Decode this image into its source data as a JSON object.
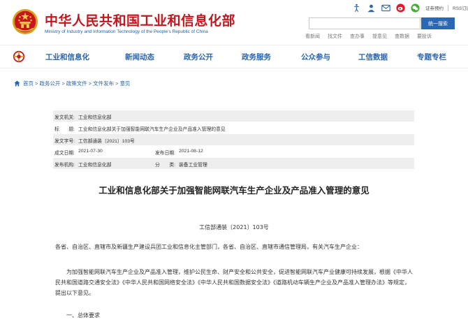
{
  "header": {
    "title": "中华人民共和国工业和信息化部",
    "subtitle": "Ministry of Industry and Information Technology of the People's Republic of China",
    "tools": {
      "icons": [
        "accessibility-icon",
        "user-icon",
        "mail-icon",
        "weibo-icon",
        "wechat-icon"
      ],
      "appointment_label": "证券预约",
      "rss_label": "RSS订阅"
    },
    "search": {
      "value": "",
      "placeholder": "",
      "button_label": "统一搜索"
    },
    "quick_links": [
      "看新闻",
      "找文件",
      "查办事",
      "提意见",
      "查数据",
      "要投诉"
    ]
  },
  "nav": {
    "items": [
      "工业和信息化",
      "新闻动态",
      "政务公开",
      "政务服务",
      "公众参与",
      "工信数据",
      "专题专栏"
    ]
  },
  "breadcrumb": {
    "items": [
      "首页",
      "政务公开",
      "政策文件",
      "文件发布",
      "意见"
    ],
    "separator": ">"
  },
  "meta": {
    "issuer_label": "发文机关:",
    "issuer": "工业和信息化部",
    "title_label": "标　　题:",
    "title": "工业和信息化部关于加强智能网联汽车生产企业及产品准入管理的意见",
    "doc_no_label": "发文字号:",
    "doc_no": "工信部通装〔2021〕103号",
    "created_label": "成文日期:",
    "created": "2021-07-30",
    "published_label": "发布日期:",
    "published": "2021-08-12",
    "org_label": "发布机构:",
    "org": "工业和信息化部",
    "category_label": "分　　类:",
    "category": "装备工业管理"
  },
  "article": {
    "title": "工业和信息化部关于加强智能网联汽车生产企业及产品准入管理的意见",
    "doc_no": "工信部通装〔2021〕103号",
    "addressee": "各省、自治区、直辖市及新疆生产建设兵团工业和信息化主管部门，各省、自治区、直辖市通信管理局，有关汽车生产企业：",
    "paragraph1": "为加强智能网联汽车生产企业及产品准入管理，维护公民生命、财产安全和公共安全，促进智能网联汽车产业健康可持续发展，根据《中华人民共和国道路交通安全法》《中华人民共和国网络安全法》《中华人民共和国数据安全法》《道路机动车辆生产企业及产品准入管理办法》等规定，提出以下意见。",
    "section1": "一、总体要求"
  },
  "colors": {
    "title_red": "#c4161c",
    "link_blue": "#2a64ad",
    "button_blue": "#2a68b4",
    "meta_gray": "#eeeeee"
  }
}
